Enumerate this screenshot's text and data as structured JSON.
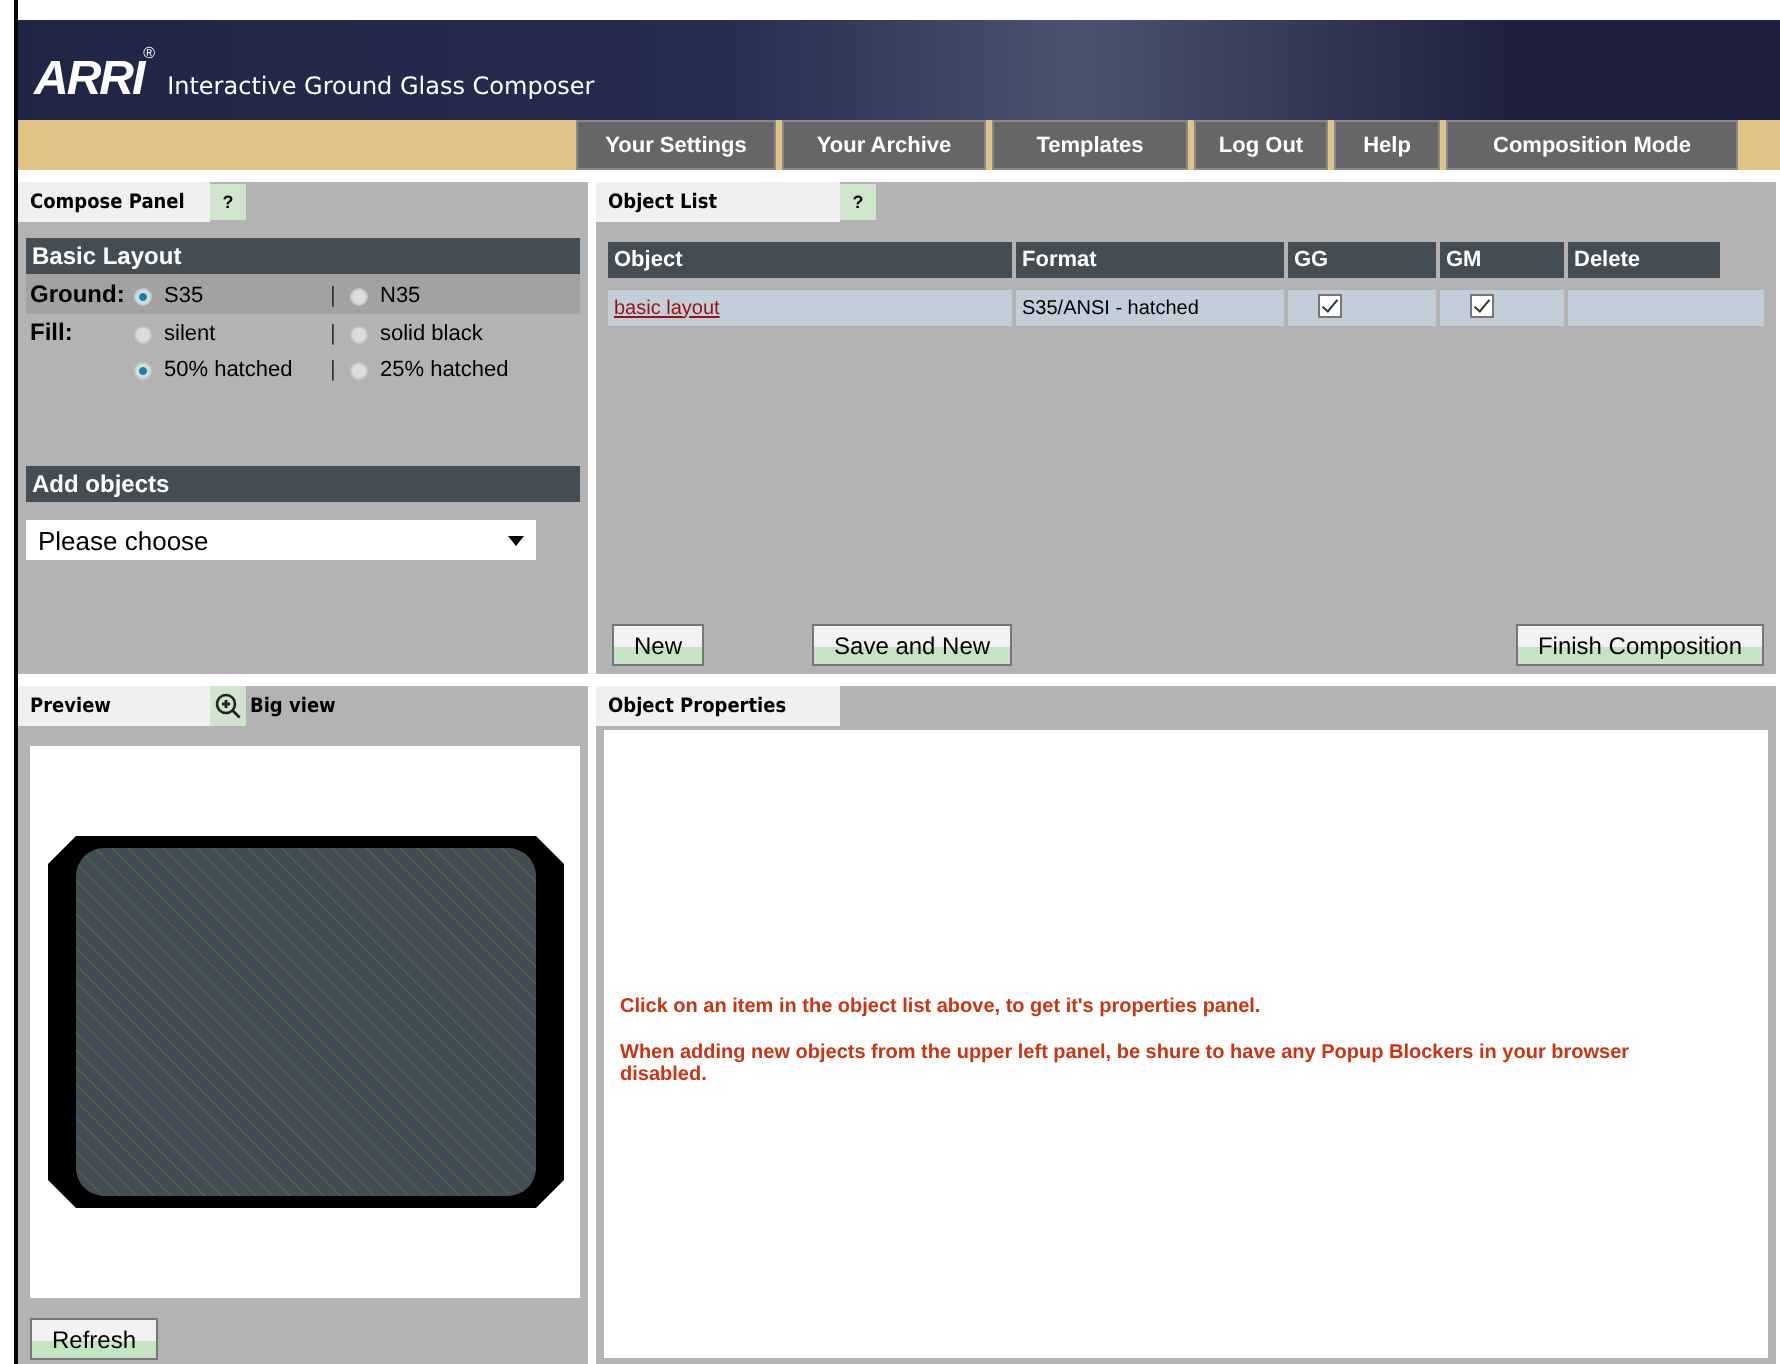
{
  "header": {
    "logo": "ARRI",
    "logo_mark": "®",
    "title": "Interactive Ground Glass Composer"
  },
  "nav": [
    {
      "label": "Your Settings"
    },
    {
      "label": "Your Archive"
    },
    {
      "label": "Templates"
    },
    {
      "label": "Log Out"
    },
    {
      "label": "Help"
    },
    {
      "label": "Composition Mode"
    }
  ],
  "compose_panel": {
    "title": "Compose Panel",
    "help": "?",
    "basic_layout": "Basic Layout",
    "ground": {
      "label": "Ground:",
      "separators": [
        "|"
      ],
      "options": [
        {
          "label": "S35",
          "selected": true
        },
        {
          "label": "N35",
          "selected": false
        }
      ]
    },
    "fill": {
      "label": "Fill:",
      "separators": [
        "|",
        "|"
      ],
      "options": [
        {
          "label": "silent",
          "selected": false
        },
        {
          "label": "solid black",
          "selected": false
        },
        {
          "label": "50% hatched",
          "selected": true
        },
        {
          "label": "25% hatched",
          "selected": false
        }
      ]
    },
    "add_objects": "Add objects",
    "select": {
      "value": "Please choose"
    }
  },
  "object_list": {
    "title": "Object List",
    "help": "?",
    "columns": [
      "Object",
      "Format",
      "GG",
      "GM",
      "Delete"
    ],
    "rows": [
      {
        "object": "basic layout",
        "format": "S35/ANSI - hatched",
        "gg": true,
        "gm": true
      }
    ],
    "buttons": [
      "New",
      "Save and New"
    ],
    "finish": "Finish Composition"
  },
  "preview": {
    "title": "Preview",
    "big_view": "Big view",
    "refresh": "Refresh"
  },
  "properties": {
    "title": "Object Properties",
    "messages": [
      "Click on an item in the object list above, to get it's properties panel.",
      "When adding new objects from the upper left panel, be shure to have any Popup Blockers in your browser disabled."
    ]
  }
}
